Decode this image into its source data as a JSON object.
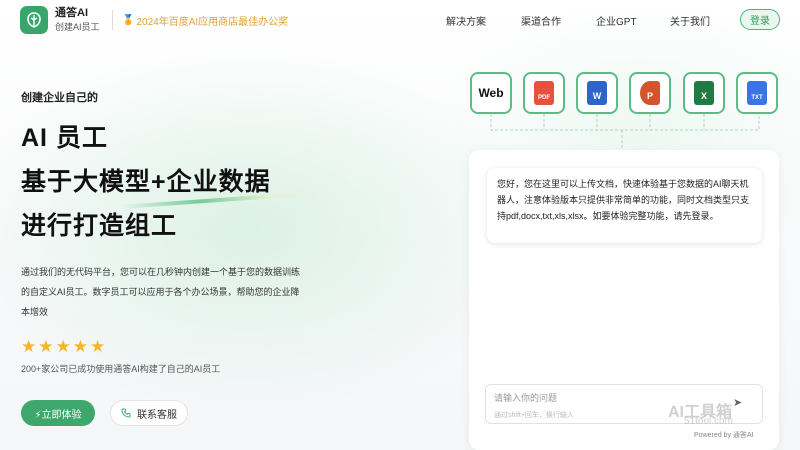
{
  "header": {
    "brand_name": "通答AI",
    "brand_sub": "创建AI员工",
    "award": "2024年百度AI应用商店最佳办公奖",
    "nav": [
      "解决方案",
      "渠道合作",
      "企业GPT",
      "关于我们"
    ],
    "login": "登录"
  },
  "hero": {
    "eyebrow": "创建企业自己的",
    "line1": "AI 员工",
    "line2": "基于大模型+企业数据",
    "line3": "进行打造组工",
    "description": "通过我们的无代码平台，您可以在几秒钟内创建一个基于您的数据训练的自定义AI员工。数字员工可以应用于各个办公场景，帮助您的企业降本增效",
    "rating": 5,
    "social_proof": "200+家公司已成功使用通答AI构建了自己的AI员工",
    "cta": "⚡立即体验",
    "contact": "联系客服"
  },
  "formats": [
    {
      "label": "Web",
      "icon": "web-icon"
    },
    {
      "label": "PDF",
      "icon": "pdf-file-icon",
      "color": "#e5533d"
    },
    {
      "label": "W",
      "icon": "word-file-icon",
      "color": "#2b66c8"
    },
    {
      "label": "P",
      "icon": "powerpoint-file-icon",
      "color": "#d2532c"
    },
    {
      "label": "X",
      "icon": "excel-file-icon",
      "color": "#1f7a43"
    },
    {
      "label": "TXT",
      "icon": "txt-file-icon",
      "color": "#3b74e6"
    }
  ],
  "chat": {
    "greeting": "您好，您在这里可以上传文档，快速体验基于您数据的AI聊天机器人，注意体验版本只提供非常简单的功能，同时文档类型只支持pdf,docx,txt,xls,xlsx。如要体验完整功能，请先登录。",
    "input_placeholder": "请输入你的问题",
    "input_hint": "通过shift+回车，换行输入",
    "powered_by": "Powered by 通答AI"
  },
  "watermark": {
    "line1": "AI工具箱",
    "line2": "51tool.com"
  },
  "colors": {
    "accent": "#3ea86c",
    "star": "#f5b62c",
    "award": "#e0a13a"
  }
}
